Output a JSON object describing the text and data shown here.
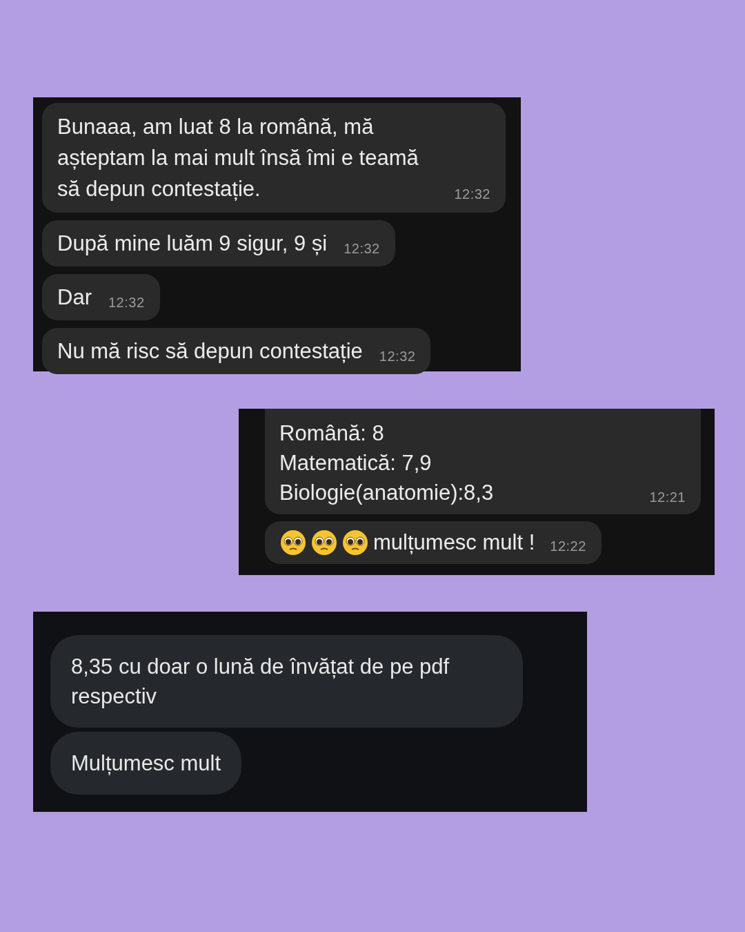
{
  "chat_1": {
    "messages": [
      {
        "text": "Bunaaa, am luat 8 la română, mă așteptam la mai mult însă îmi e teamă să depun contestație.",
        "time": "12:32"
      },
      {
        "text": "După mine luăm 9 sigur, 9 și",
        "time": "12:32"
      },
      {
        "text": "Dar",
        "time": "12:32"
      },
      {
        "text": "Nu mă risc să depun contestație",
        "time": "12:32"
      }
    ]
  },
  "chat_2": {
    "messages": [
      {
        "lines": [
          "Română: 8",
          "Matematică: 7,9",
          "Biologie(anatomie):8,3"
        ],
        "time": "12:21"
      },
      {
        "emojis": [
          {
            "kind": "pleading"
          },
          {
            "kind": "pleading"
          },
          {
            "kind": "pleading"
          }
        ],
        "text": "mulțumesc mult !",
        "time": "12:22"
      }
    ]
  },
  "chat_3": {
    "messages": [
      {
        "text": "8,35 cu doar o lună de învățat de pe pdf respectiv"
      },
      {
        "text": "Mulțumesc mult"
      }
    ]
  }
}
